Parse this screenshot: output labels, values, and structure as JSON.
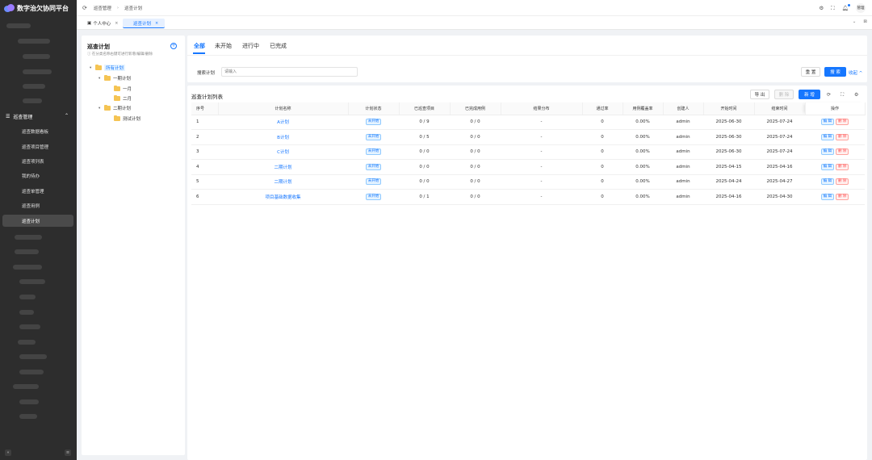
{
  "app": {
    "title": "数字治欠协同平台",
    "accent": "#1677ff"
  },
  "sidebar": {
    "group_label": "巡查管理",
    "group_icon": "list-icon",
    "items": [
      {
        "label": "巡查数据看板"
      },
      {
        "label": "巡查项目管理"
      },
      {
        "label": "巡查项列表"
      },
      {
        "label": "我的待办"
      },
      {
        "label": "巡查单管理"
      },
      {
        "label": "巡查用例"
      },
      {
        "label": "巡查计划"
      }
    ]
  },
  "topbar": {
    "breadcrumb": [
      "巡查管理",
      "巡查计划"
    ],
    "avatar_text": "管理"
  },
  "tabs": [
    {
      "label": "个人中心"
    },
    {
      "label": "巡查计划"
    }
  ],
  "tree_panel": {
    "title": "巡查计划",
    "hint": "ⓘ 在分类名称右键可进行新增/编辑/删除",
    "nodes": [
      {
        "label": "所有计划"
      },
      {
        "label": "一期计划"
      },
      {
        "label": "一月"
      },
      {
        "label": "二月"
      },
      {
        "label": "二期计划"
      },
      {
        "label": "测试计划"
      }
    ]
  },
  "status_tabs": [
    "全部",
    "未开始",
    "进行中",
    "已完成"
  ],
  "search": {
    "label": "搜索计划",
    "placeholder": "请输入",
    "reset_label": "重 置",
    "search_label": "搜 索",
    "collapse_label": "收起"
  },
  "table": {
    "title": "巡查计划列表",
    "export_label": "导 出",
    "delete_label": "删 除",
    "add_label": "新 增",
    "columns": [
      "序号",
      "计划名称",
      "计划状态",
      "已巡查项目",
      "已完成用例",
      "结果分布",
      "通过率",
      "用例覆盖率",
      "创建人",
      "开始时间",
      "结束时间",
      "操作"
    ],
    "edit_label": "编 辑",
    "row_delete_label": "删 除",
    "rows": [
      {
        "no": "1",
        "name": "A计划",
        "status": "未开始",
        "inspected": "0 / 9",
        "done_cases": "0 / 0",
        "result": "-",
        "pass_rate": "0",
        "coverage": "0.00%",
        "creator": "admin",
        "start": "2025-06-30",
        "end": "2025-07-24"
      },
      {
        "no": "2",
        "name": "B计划",
        "status": "未开始",
        "inspected": "0 / 5",
        "done_cases": "0 / 0",
        "result": "-",
        "pass_rate": "0",
        "coverage": "0.00%",
        "creator": "admin",
        "start": "2025-06-30",
        "end": "2025-07-24"
      },
      {
        "no": "3",
        "name": "C计划",
        "status": "未开始",
        "inspected": "0 / 0",
        "done_cases": "0 / 0",
        "result": "-",
        "pass_rate": "0",
        "coverage": "0.00%",
        "creator": "admin",
        "start": "2025-06-30",
        "end": "2025-07-24"
      },
      {
        "no": "4",
        "name": "二期计划",
        "status": "未开始",
        "inspected": "0 / 0",
        "done_cases": "0 / 0",
        "result": "-",
        "pass_rate": "0",
        "coverage": "0.00%",
        "creator": "admin",
        "start": "2025-04-15",
        "end": "2025-04-16"
      },
      {
        "no": "5",
        "name": "二期计划",
        "status": "未开始",
        "inspected": "0 / 0",
        "done_cases": "0 / 0",
        "result": "-",
        "pass_rate": "0",
        "coverage": "0.00%",
        "creator": "admin",
        "start": "2025-04-24",
        "end": "2025-04-27"
      },
      {
        "no": "6",
        "name": "项目基础数据收集",
        "status": "未开始",
        "inspected": "0 / 1",
        "done_cases": "0 / 0",
        "result": "-",
        "pass_rate": "0",
        "coverage": "0.00%",
        "creator": "admin",
        "start": "2025-04-16",
        "end": "2025-04-30"
      }
    ]
  }
}
